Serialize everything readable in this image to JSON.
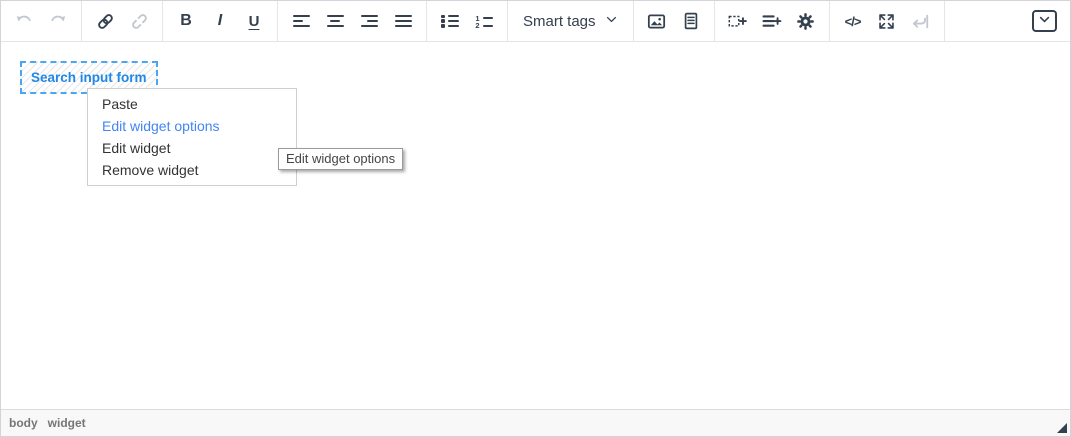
{
  "colors": {
    "icon": "#35404f",
    "icon_disabled": "#c3c8d0",
    "widget_border": "#4aa5f5",
    "widget_text": "#2187e7",
    "menu_highlight_text": "#4285f4",
    "toolbar_separator": "#e3e5e8",
    "statusbar_bg": "#f8f8f8",
    "statusbar_text": "#767676"
  },
  "toolbar": {
    "bold_label": "B",
    "italic_label": "I",
    "underline_label": "U",
    "smart_tags_label": "Smart tags",
    "source_code_label": "</>",
    "numbered_list_digits": [
      "1",
      "2"
    ]
  },
  "widget": {
    "label": "Search input form"
  },
  "context_menu": {
    "items": [
      {
        "label": "Paste",
        "highlighted": false
      },
      {
        "label": "Edit widget options",
        "highlighted": true
      },
      {
        "label": "Edit widget",
        "highlighted": false
      },
      {
        "label": "Remove widget",
        "highlighted": false
      }
    ]
  },
  "tooltip": {
    "text": "Edit widget options"
  },
  "status_bar": {
    "path": [
      "body",
      "widget"
    ]
  }
}
